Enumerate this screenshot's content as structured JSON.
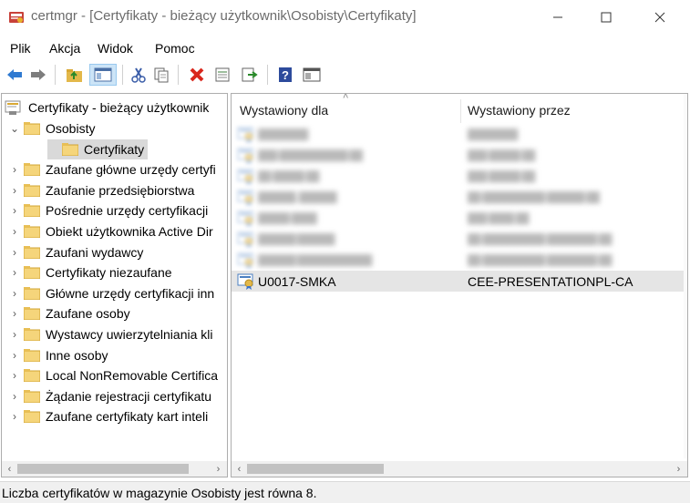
{
  "window": {
    "title": "certmgr - [Certyfikaty - bieżący użytkownik\\Osobisty\\Certyfikaty]",
    "minimize": "—",
    "maximize": "☐",
    "close": "✕"
  },
  "menu": [
    "Plik",
    "Akcja",
    "Widok",
    "Pomoc"
  ],
  "toolbar_icons": [
    "back-arrow-icon",
    "forward-arrow-icon",
    "up-folder-icon",
    "show-hide-tree-icon",
    "cut-icon",
    "copy-icon",
    "delete-icon",
    "properties-icon",
    "export-icon",
    "help-icon",
    "console-icon"
  ],
  "tree": {
    "root": "Certyfikaty - bieżący użytkownik",
    "items": [
      {
        "label": "Osobisty",
        "expander": "⌄"
      },
      {
        "label": "Certyfikaty",
        "expander": ""
      },
      {
        "label": "Zaufane główne urzędy certyfi",
        "expander": "›"
      },
      {
        "label": "Zaufanie przedsiębiorstwa",
        "expander": "›"
      },
      {
        "label": "Pośrednie urzędy certyfikacji",
        "expander": "›"
      },
      {
        "label": "Obiekt użytkownika Active Dir",
        "expander": "›"
      },
      {
        "label": "Zaufani wydawcy",
        "expander": "›"
      },
      {
        "label": "Certyfikaty niezaufane",
        "expander": "›"
      },
      {
        "label": "Główne urzędy certyfikacji inn",
        "expander": "›"
      },
      {
        "label": "Zaufane osoby",
        "expander": "›"
      },
      {
        "label": "Wystawcy uwierzytelniania kli",
        "expander": "›"
      },
      {
        "label": "Inne osoby",
        "expander": "›"
      },
      {
        "label": "Local NonRemovable Certifica",
        "expander": "›"
      },
      {
        "label": "Żądanie rejestracji certyfikatu",
        "expander": "›"
      },
      {
        "label": "Zaufane certyfikaty kart inteli",
        "expander": "›"
      }
    ]
  },
  "list": {
    "columns": [
      "Wystawiony dla",
      "Wystawiony przez"
    ],
    "sort_indicator": "˄",
    "rows": [
      {
        "issued_to": "",
        "issued_by": ""
      },
      {
        "issued_to": "",
        "issued_by": ""
      },
      {
        "issued_to": "",
        "issued_by": ""
      },
      {
        "issued_to": "",
        "issued_by": ""
      },
      {
        "issued_to": "",
        "issued_by": ""
      },
      {
        "issued_to": "",
        "issued_by": ""
      },
      {
        "issued_to": "",
        "issued_by": ""
      },
      {
        "issued_to": "U0017-SMKA",
        "issued_by": "CEE-PRESENTATIONPL-CA"
      }
    ]
  },
  "scroll": {
    "left": "‹",
    "right": "›"
  },
  "status": "Liczba certyfikatów w magazynie Osobisty jest równa 8."
}
